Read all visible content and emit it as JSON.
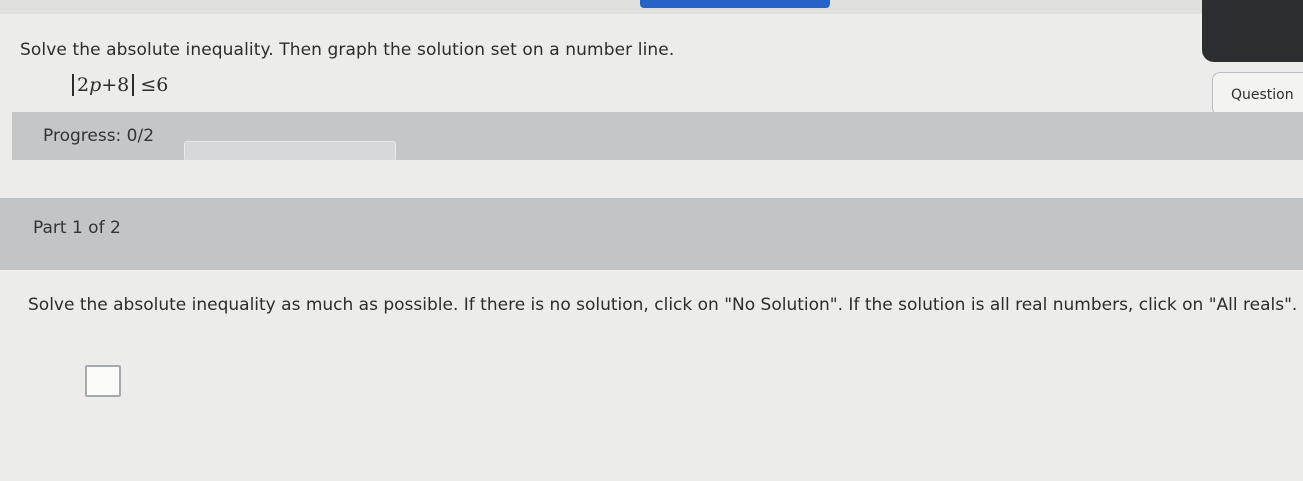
{
  "problem": {
    "statement": "Solve the absolute inequality. Then graph the solution set on a number line.",
    "inequality": {
      "abs_coefficient": "2",
      "abs_variable": "p",
      "abs_rest": "+8",
      "relation": "≤",
      "rhs": "6"
    }
  },
  "header": {
    "question_button_label": "Question"
  },
  "progress": {
    "label": "Progress: 0/2",
    "fraction": 0
  },
  "part": {
    "label": "Part 1 of 2",
    "instructions": "Solve the absolute inequality as much as possible. If there is no solution, click on \"No Solution\". If the solution is all real numbers, click on \"All reals\"."
  },
  "colors": {
    "accent": "#2563c9",
    "band": "#c3c7ca",
    "page": "#ececea"
  }
}
